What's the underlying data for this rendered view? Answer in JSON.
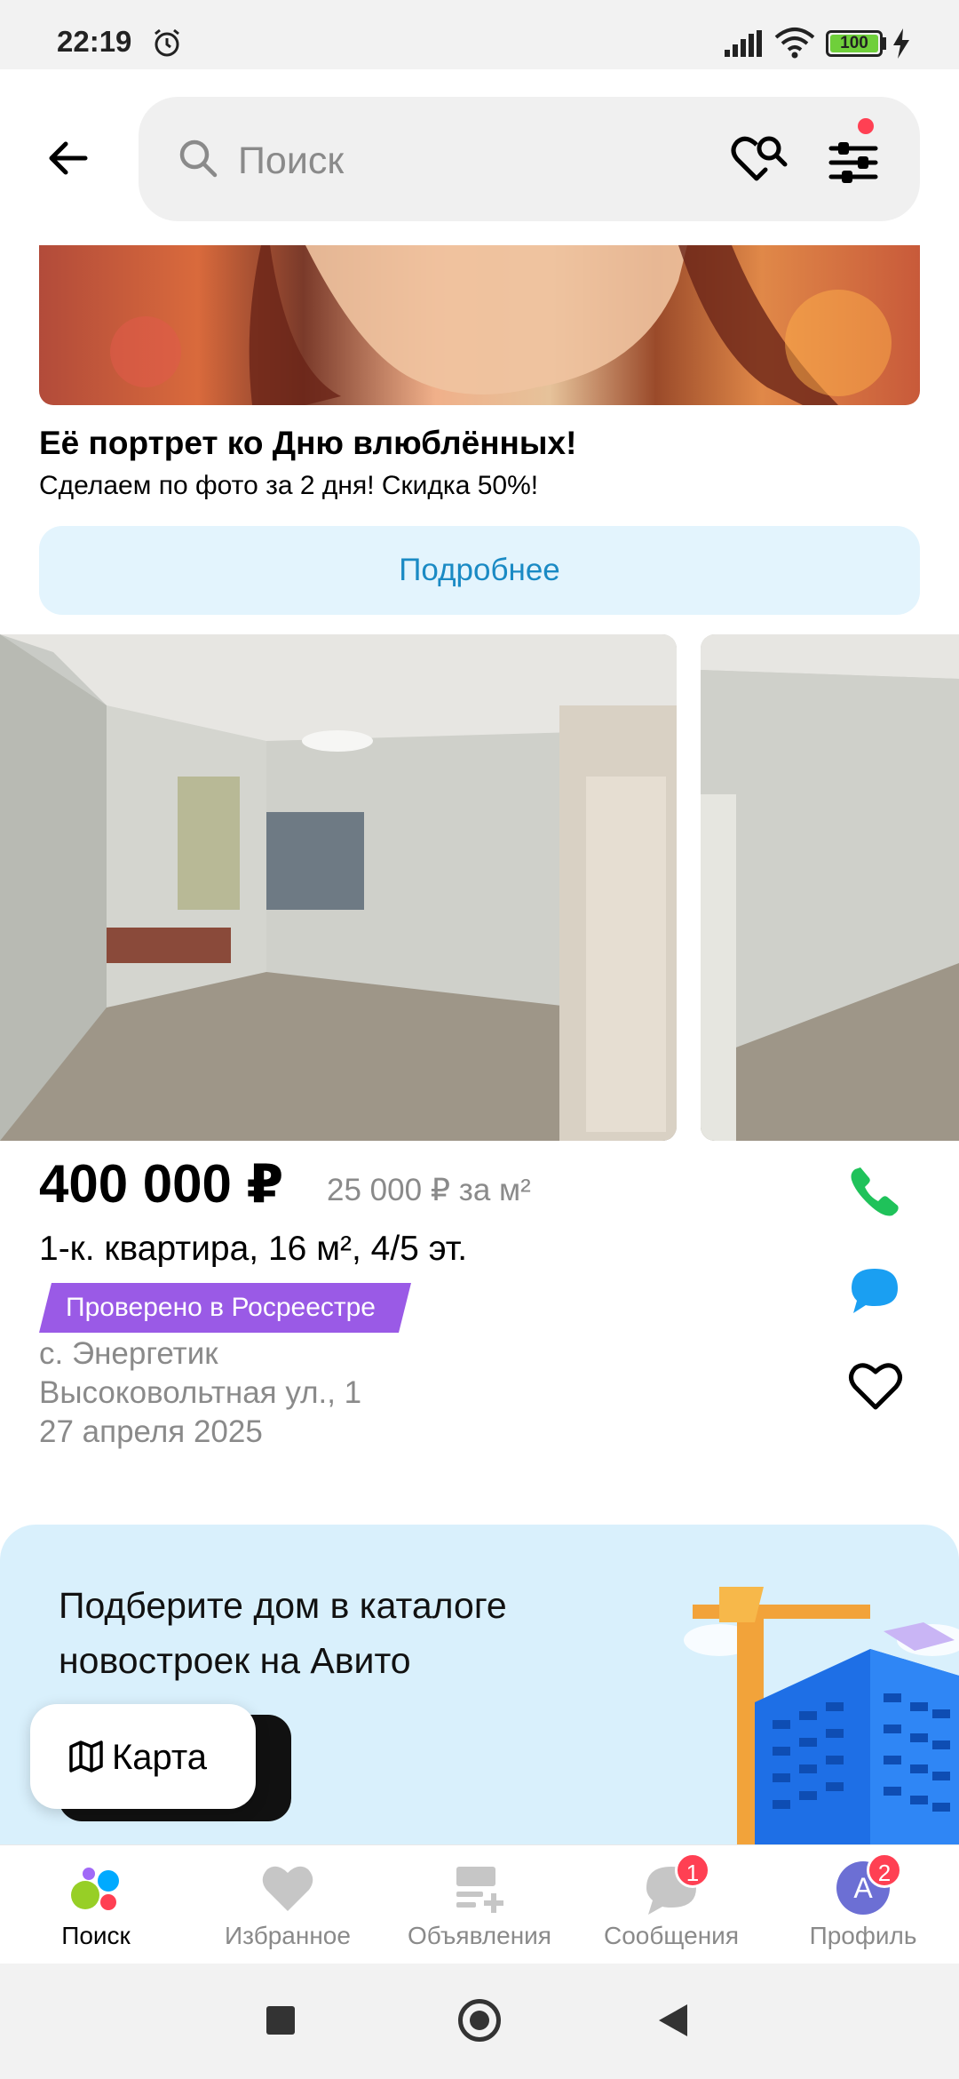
{
  "status_bar": {
    "time": "22:19",
    "battery": "100",
    "icons": [
      "alarm-icon",
      "signal-icon",
      "wifi-icon",
      "battery-icon",
      "charging-icon"
    ]
  },
  "header": {
    "search_placeholder": "Поиск",
    "icons": [
      "back-arrow-icon",
      "search-icon",
      "saved-search-heart-icon",
      "filter-icon"
    ],
    "filter_dot_color": "#ff4053"
  },
  "ad": {
    "title": "Её портрет ко Дню влюблённых!",
    "subtitle": "Сделаем по фото за 2 дня! Скидка 50%!",
    "button_label": "Подробнее"
  },
  "listing": {
    "price": "400 000 ₽",
    "price_per_m2": "25 000 ₽ за м²",
    "title": "1-к. квартира, 16 м², 4/5 эт.",
    "badge": "Проверено в Росреестре",
    "badge_color": "#9a5ae6",
    "location_line1": "с. Энергетик",
    "location_line2": "Высоковольтная ул., 1",
    "date": "27 апреля 2025",
    "actions": [
      "phone-icon",
      "chat-icon",
      "heart-icon"
    ],
    "action_color_phone": "#1fc25a",
    "action_color_chat": "#1a9ff2"
  },
  "promo": {
    "text": "Подберите дом в каталоге новостроек на Авито"
  },
  "map_button": {
    "label": "Карта"
  },
  "bottom_nav": {
    "items": [
      {
        "label": "Поиск",
        "icon": "avito-logo-icon",
        "active": true
      },
      {
        "label": "Избранное",
        "icon": "heart-icon"
      },
      {
        "label": "Объявления",
        "icon": "listings-add-icon"
      },
      {
        "label": "Сообщения",
        "icon": "messages-icon",
        "badge": "1"
      },
      {
        "label": "Профиль",
        "icon": "avatar",
        "avatar_letter": "A",
        "badge": "2"
      }
    ]
  }
}
